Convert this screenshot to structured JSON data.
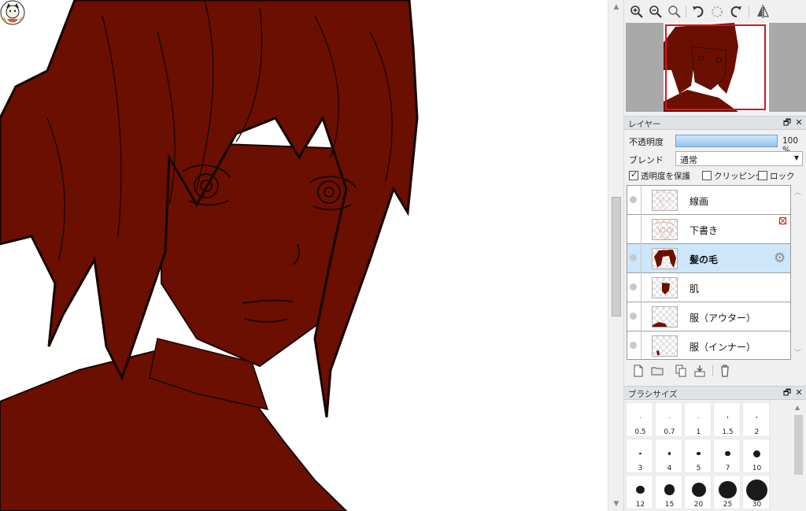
{
  "icons": {
    "zoom_in": "zoom-in-icon",
    "zoom_out": "zoom-out-icon",
    "zoom_reset": "zoom-reset-icon",
    "rotate_left": "rotate-left-icon",
    "rotate_reset": "rotate-reset-icon",
    "rotate_right": "rotate-right-icon",
    "flip": "flip-horizontal-icon",
    "mascot": "mascot-icon"
  },
  "colors": {
    "accent_red": "#d7161e",
    "hair_dark_red": "#6b0f00",
    "selection_blue": "#cde6fa"
  },
  "layer_panel": {
    "title": "レイヤー",
    "opacity_label": "不透明度",
    "opacity_percent": 100,
    "opacity_value": "100 %",
    "blend_label": "ブレンド",
    "blend_value": "通常",
    "protect_alpha_label": "透明度を保護",
    "protect_alpha_checked": true,
    "clipping_label": "クリッピング",
    "clipping_checked": false,
    "lock_label": "ロック",
    "lock_checked": false,
    "layers": [
      {
        "name": "線画",
        "visible": true,
        "selected": false,
        "thumb": "lineart"
      },
      {
        "name": "下書き",
        "visible": false,
        "selected": false,
        "thumb": "sketch"
      },
      {
        "name": "髪の毛",
        "visible": true,
        "selected": true,
        "thumb": "hair"
      },
      {
        "name": "肌",
        "visible": true,
        "selected": false,
        "thumb": "skin"
      },
      {
        "name": "服（アウター）",
        "visible": true,
        "selected": false,
        "thumb": "outer"
      },
      {
        "name": "服（インナー）",
        "visible": true,
        "selected": false,
        "thumb": "inner"
      }
    ],
    "toolbar_icons": [
      "new-layer-icon",
      "new-folder-icon",
      "duplicate-layer-icon",
      "merge-down-icon",
      "delete-layer-icon"
    ]
  },
  "brush_panel": {
    "title": "ブラシサイズ",
    "sizes": [
      "0.5",
      "0.7",
      "1",
      "1.5",
      "2",
      "3",
      "4",
      "5",
      "7",
      "10",
      "12",
      "15",
      "20",
      "25",
      "30"
    ]
  }
}
